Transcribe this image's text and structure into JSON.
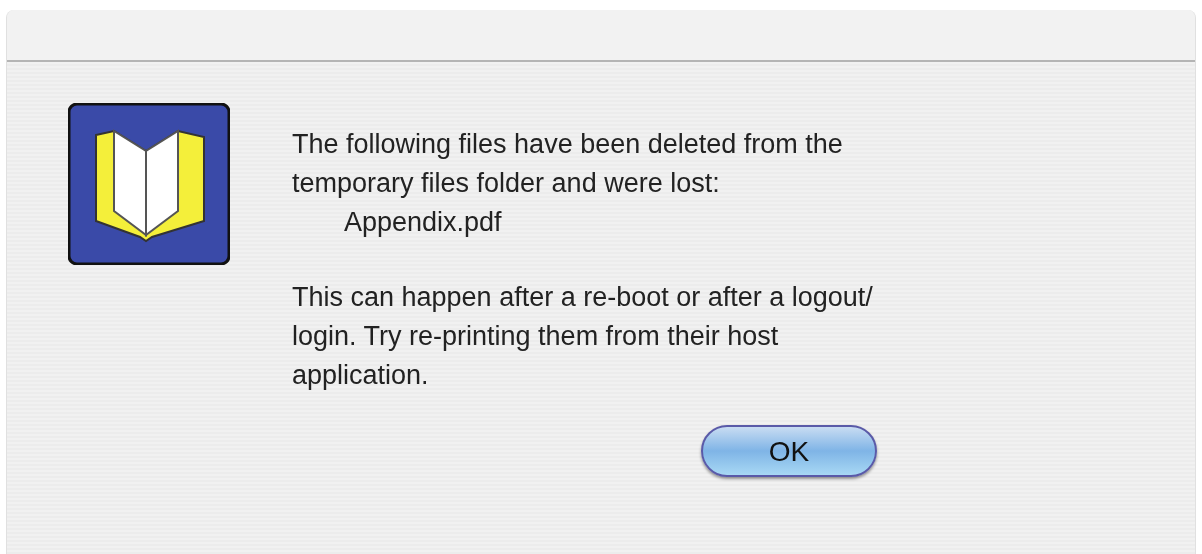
{
  "dialog": {
    "message": "The following files have been deleted from the\ntemporary files folder and were lost:",
    "file_name": "Appendix.pdf",
    "explanation": "This can happen after a re-boot or after a logout/\nlogin. Try re-printing them from their host\napplication.",
    "buttons": [
      {
        "label": "OK",
        "default": true
      }
    ]
  }
}
